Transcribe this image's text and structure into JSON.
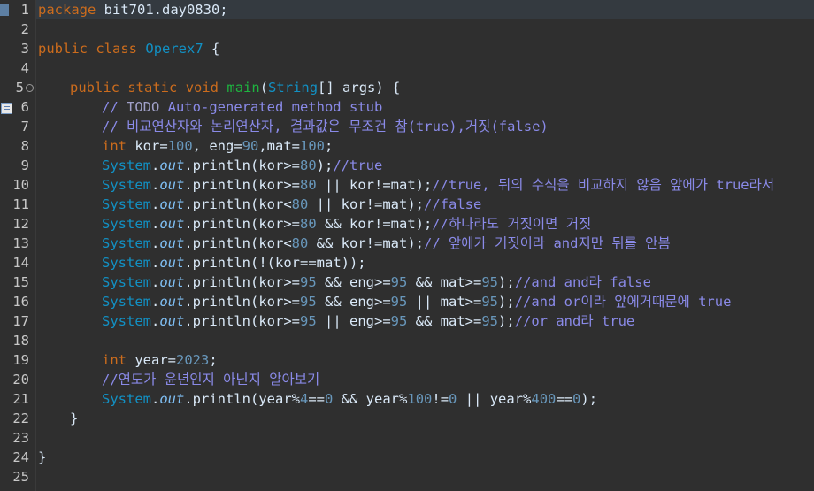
{
  "editor": {
    "line_numbers": [
      "1",
      "2",
      "3",
      "4",
      "5",
      "6",
      "7",
      "8",
      "9",
      "10",
      "11",
      "12",
      "13",
      "14",
      "15",
      "16",
      "17",
      "18",
      "19",
      "20",
      "21",
      "22",
      "23",
      "24",
      "25"
    ],
    "lines": {
      "l1": {
        "kw": "package",
        "rest": " bit701.day0830;"
      },
      "l3": {
        "kw1": "public",
        "kw2": "class",
        "cls": "Operex7",
        "rest": " {"
      },
      "l5": {
        "kw1": "public",
        "kw2": "static",
        "kw3": "void",
        "meth": "main",
        "p1": "(",
        "cls": "String",
        "rest": "[] args) {"
      },
      "l6": {
        "cmt": "// ",
        "todo": "TODO",
        "cmt2": " Auto-generated method stub"
      },
      "l7": {
        "cmt": "// 비교연산자와 논리연산자, 결과값은 무조건 참(true),거짓(false)"
      },
      "l8": {
        "kw": "int",
        "a": " kor=",
        "n1": "100",
        "b": ", eng=",
        "n2": "90",
        "c": ",mat=",
        "n3": "100",
        "d": ";"
      },
      "l9": {
        "cls": "System",
        "dot": ".",
        "stat": "out",
        "a": ".println(kor>=",
        "n1": "80",
        "b": ");",
        "cmt": "//true"
      },
      "l10": {
        "cls": "System",
        "dot": ".",
        "stat": "out",
        "a": ".println(kor>=",
        "n1": "80",
        "b": " || kor!=mat);",
        "cmt": "//true, 뒤의 수식을 비교하지 않음 앞에가 true라서"
      },
      "l11": {
        "cls": "System",
        "dot": ".",
        "stat": "out",
        "a": ".println(kor<",
        "n1": "80",
        "b": " || kor!=mat);",
        "cmt": "//false"
      },
      "l12": {
        "cls": "System",
        "dot": ".",
        "stat": "out",
        "a": ".println(kor>=",
        "n1": "80",
        "b": " && kor!=mat);",
        "cmt": "//하나라도 거짓이면 거짓"
      },
      "l13": {
        "cls": "System",
        "dot": ".",
        "stat": "out",
        "a": ".println(kor<",
        "n1": "80",
        "b": " && kor!=mat);",
        "cmt": "// 앞에가 거짓이라 and지만 뒤를 안봄"
      },
      "l14": {
        "cls": "System",
        "dot": ".",
        "stat": "out",
        "a": ".println(!(kor==mat));"
      },
      "l15": {
        "cls": "System",
        "dot": ".",
        "stat": "out",
        "a": ".println(kor>=",
        "n1": "95",
        "b": " && eng>=",
        "n2": "95",
        "c": " && mat>=",
        "n3": "95",
        "d": ");",
        "cmt": "//and and라 false"
      },
      "l16": {
        "cls": "System",
        "dot": ".",
        "stat": "out",
        "a": ".println(kor>=",
        "n1": "95",
        "b": " && eng>=",
        "n2": "95",
        "c": " || mat>=",
        "n3": "95",
        "d": ");",
        "cmt": "//and or이라 앞에거때문에 true"
      },
      "l17": {
        "cls": "System",
        "dot": ".",
        "stat": "out",
        "a": ".println(kor>=",
        "n1": "95",
        "b": " || eng>=",
        "n2": "95",
        "c": " && mat>=",
        "n3": "95",
        "d": ");",
        "cmt": "//or and라 true"
      },
      "l19": {
        "kw": "int",
        "a": " year=",
        "n1": "2023",
        "b": ";"
      },
      "l20": {
        "cmt": "//연도가 윤년인지 아닌지 알아보기"
      },
      "l21": {
        "cls": "System",
        "dot": ".",
        "stat": "out",
        "a": ".println(year%",
        "n1": "4",
        "b": "==",
        "n2": "0",
        "c": " && year%",
        "n3": "100",
        "d": "!=",
        "n4": "0",
        "e": " || year%",
        "n5": "400",
        "f": "==",
        "n6": "0",
        "g": ");"
      },
      "l22": {
        "a": "}"
      },
      "l24": {
        "a": "}"
      }
    }
  }
}
